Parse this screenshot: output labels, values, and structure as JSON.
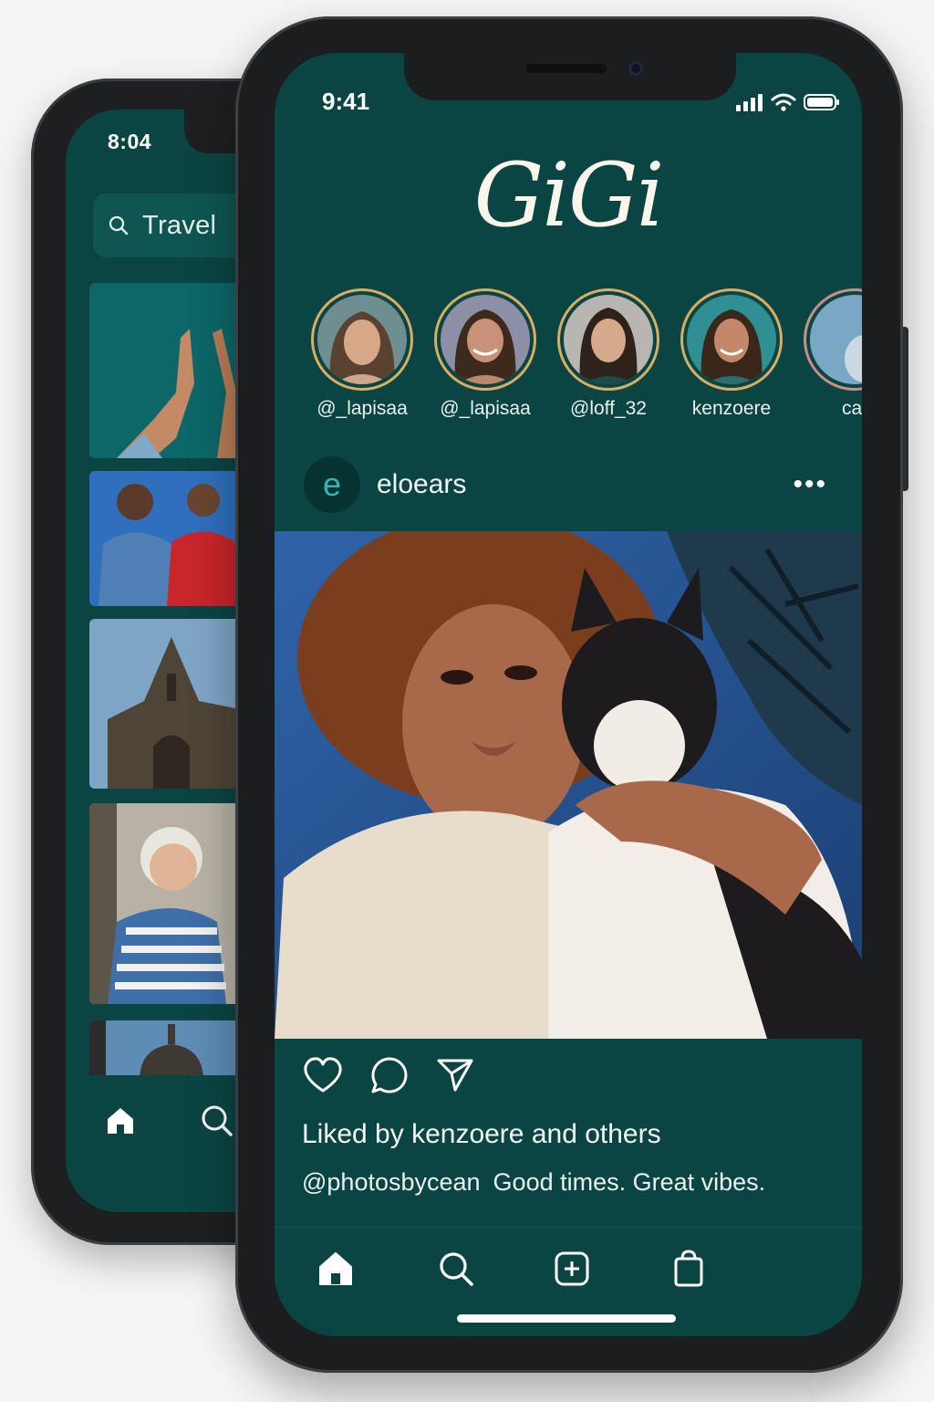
{
  "back_screen": {
    "status_time": "8:04",
    "search_query": "Travel"
  },
  "front_screen": {
    "status_time": "9:41",
    "app_title": "GiGi",
    "stories": [
      {
        "username": "@_lapisaa"
      },
      {
        "username": "@_lapisaa"
      },
      {
        "username": "@loff_32"
      },
      {
        "username": "kenzoere"
      },
      {
        "username": "cat"
      }
    ],
    "post": {
      "avatar_letter": "e",
      "username": "eloears",
      "more_label": "•••",
      "liked_by": "Liked by kenzoere and others",
      "caption_handle": "@photosbycean",
      "caption_text": "Good times. Great vibes."
    }
  },
  "icons": {
    "status": [
      "signal-icon",
      "wifi-icon",
      "battery-icon"
    ],
    "actions": [
      "heart-icon",
      "comment-icon",
      "send-icon"
    ],
    "tabbar": [
      "home-icon",
      "search-icon",
      "add-post-icon",
      "bag-icon"
    ]
  },
  "colors": {
    "app_background": "#0b4543",
    "story_ring": "#d9ad62",
    "avatar_letter": "#34b7b3",
    "text": "#f1f6f5"
  }
}
